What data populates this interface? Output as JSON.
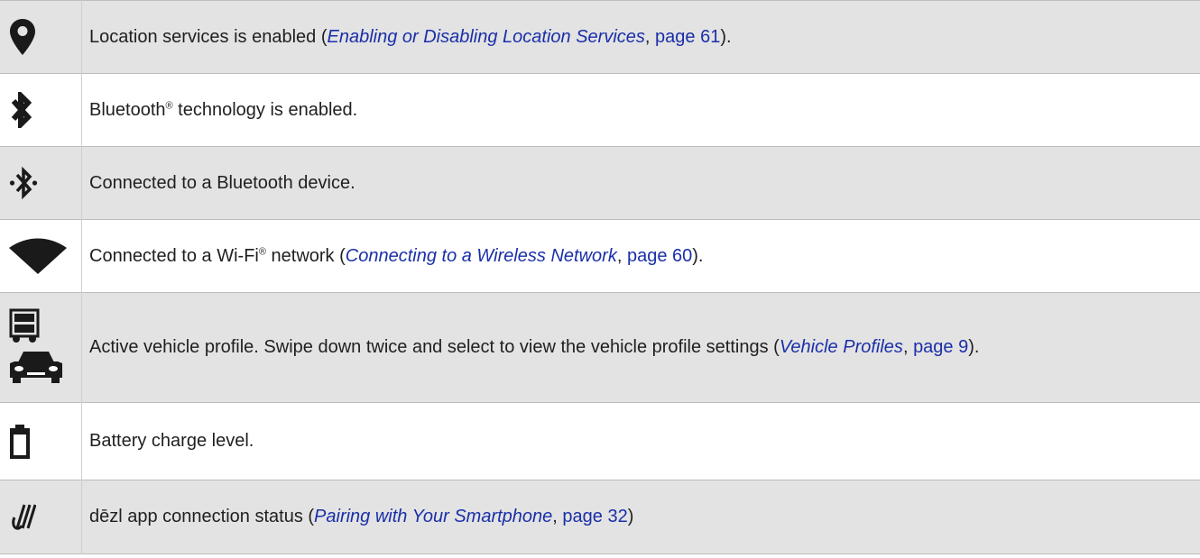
{
  "rows": [
    {
      "icon": "location-pin-icon",
      "text_before": "Location services is enabled (",
      "link": "Enabling or Disabling Location Services",
      "page_ref": "page 61",
      "text_after": ")."
    },
    {
      "icon": "bluetooth-icon",
      "text_before": "Bluetooth",
      "superscript": "®",
      "text_after": " technology is enabled."
    },
    {
      "icon": "bluetooth-connected-icon",
      "text": "Connected to a Bluetooth device."
    },
    {
      "icon": "wifi-icon",
      "text_before": "Connected to a Wi-Fi",
      "superscript": "®",
      "text_middle": " network (",
      "link": "Connecting to a Wireless Network",
      "page_ref": "page 60",
      "text_after": ")."
    },
    {
      "icons": [
        "truck-icon",
        "car-icon"
      ],
      "text_before": "Active vehicle profile. Swipe down twice and select to view the vehicle profile settings (",
      "link": "Vehicle Profiles",
      "page_ref": "page 9",
      "text_after": ")."
    },
    {
      "icon": "battery-icon",
      "text": "Battery charge level."
    },
    {
      "icon": "dezl-app-icon",
      "text_before": "dēzl app connection status (",
      "link": "Pairing with Your Smartphone",
      "page_ref": "page 32",
      "text_after": ")"
    }
  ],
  "separator": ", "
}
